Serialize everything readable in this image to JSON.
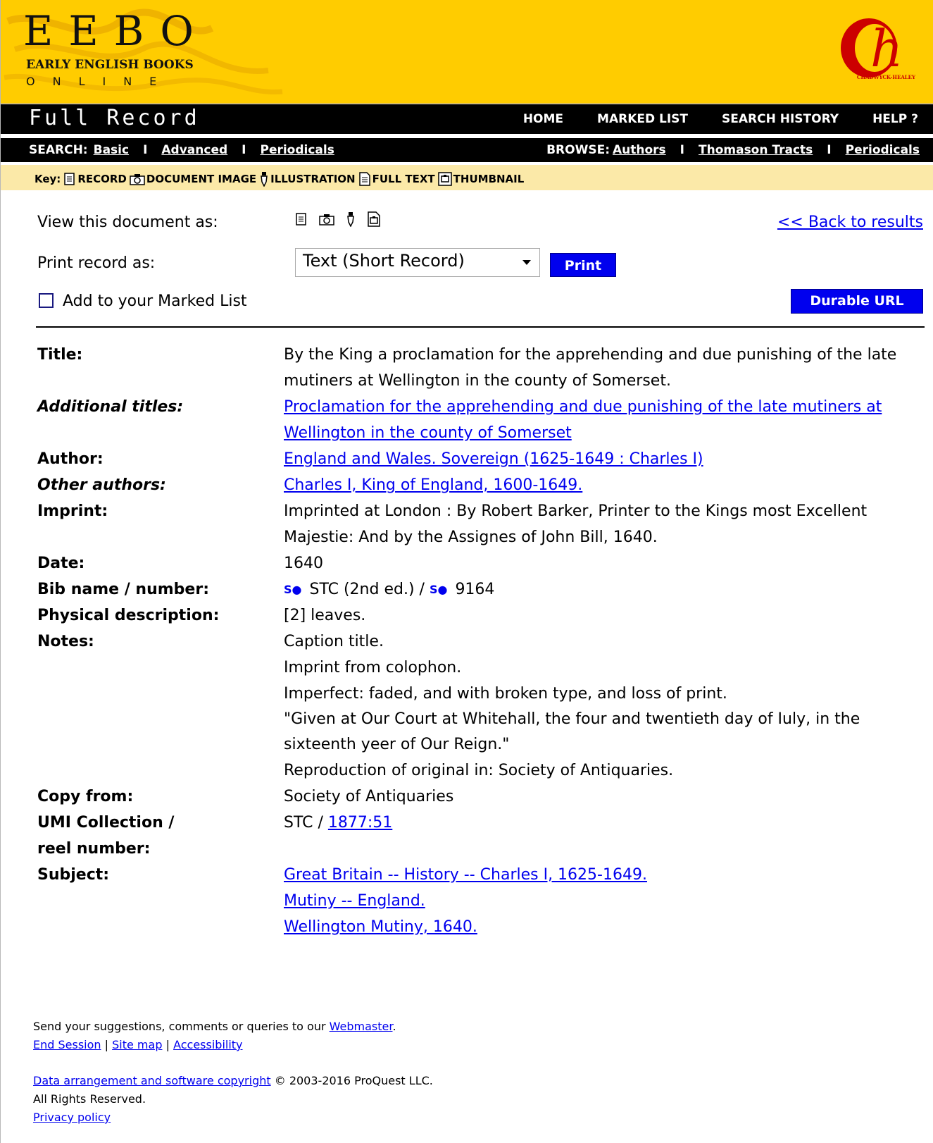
{
  "header": {
    "logo_main": "EEBO",
    "logo_line1": "EARLY ENGLISH BOOKS",
    "logo_line2": "ONLINE",
    "publisher_logo_text": "CHADWYCK-HEALEY",
    "page_title": "Full Record",
    "nav": [
      "HOME",
      "MARKED LIST",
      "SEARCH HISTORY",
      "HELP ?"
    ]
  },
  "searchbar": {
    "search_label": "SEARCH:",
    "search_links": [
      "Basic",
      "Advanced",
      "Periodicals"
    ],
    "browse_label": "BROWSE:",
    "browse_links": [
      "Authors",
      "Thomason Tracts",
      "Periodicals"
    ],
    "separator": "I"
  },
  "key": {
    "label": "Key:",
    "items": [
      {
        "icon": "record-icon",
        "label": "RECORD"
      },
      {
        "icon": "camera-icon",
        "label": "DOCUMENT IMAGE"
      },
      {
        "icon": "pen-icon",
        "label": "ILLUSTRATION"
      },
      {
        "icon": "fulltext-icon",
        "label": "FULL TEXT"
      },
      {
        "icon": "thumbnail-icon",
        "label": "THUMBNAIL"
      }
    ]
  },
  "controls": {
    "view_label": "View this document as:",
    "back_link": "<< Back to results",
    "print_label": "Print record as:",
    "print_select_value": "Text (Short Record)",
    "print_button": "Print",
    "marked_label": "Add to your Marked List",
    "durable_button": "Durable URL"
  },
  "record": {
    "title_label": "Title:",
    "title_value": "By the King a proclamation for the apprehending and due punishing of the late mutiners at Wellington in the county of Somerset.",
    "additional_titles_label": "Additional titles:",
    "additional_titles_value": "Proclamation for the apprehending and due punishing of the late mutiners at Wellington in the county of Somerset",
    "author_label": "Author:",
    "author_value": "England and Wales. Sovereign (1625-1649 : Charles I)",
    "other_authors_label": "Other authors:",
    "other_authors_value": "Charles I, King of England, 1600-1649.",
    "imprint_label": "Imprint:",
    "imprint_value": "Imprinted at London : By Robert Barker, Printer to the Kings most Excellent Majestie: And by the Assignes of John Bill, 1640.",
    "date_label": "Date:",
    "date_value": "1640",
    "bib_label": "Bib name / number:",
    "bib_icon_text": "S",
    "bib_name": "STC (2nd ed.) /",
    "bib_number": "9164",
    "physical_label": "Physical description:",
    "physical_value": "[2] leaves.",
    "notes_label": "Notes:",
    "notes": [
      "Caption title.",
      "Imprint from colophon.",
      "Imperfect: faded, and with broken type, and loss of print.",
      "\"Given at Our Court at Whitehall, the four and twentieth day of Iuly, in the sixteenth yeer of Our Reign.\"",
      "Reproduction of original in: Society of Antiquaries."
    ],
    "copy_label": "Copy from:",
    "copy_value": "Society of Antiquaries",
    "umi_label_1": "UMI Collection /",
    "umi_label_2": "reel number:",
    "umi_prefix": "STC /",
    "umi_link": "1877:51",
    "subject_label": "Subject:",
    "subjects": [
      "Great Britain -- History -- Charles I, 1625-1649.",
      "Mutiny -- England.",
      "Wellington Mutiny, 1640."
    ]
  },
  "footer": {
    "suggest_text": "Send your suggestions, comments or queries to our",
    "webmaster_link": "Webmaster",
    "links": [
      "End Session",
      "Site map",
      "Accessibility"
    ],
    "copyright_link": "Data arrangement and software copyright",
    "copyright_text": "© 2003-2016 ProQuest LLC.",
    "rights": "All Rights Reserved.",
    "privacy_link": "Privacy policy"
  },
  "colors": {
    "banner": "#ffcc00",
    "nav_bg": "#000000",
    "key_bg": "#fbe9a8",
    "button_bg": "#0000ee",
    "link": "#0000ee",
    "publisher_logo": "#cc0000"
  }
}
